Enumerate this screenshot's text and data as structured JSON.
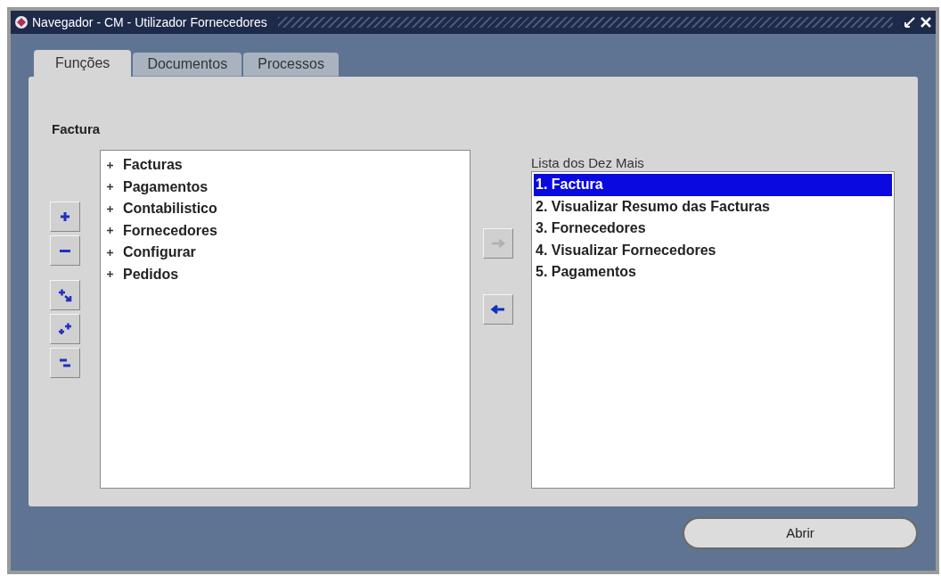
{
  "window": {
    "title": "Navegador - CM - Utilizador Fornecedores"
  },
  "tabs": [
    {
      "label": "Funções",
      "selected": true
    },
    {
      "label": "Documentos",
      "selected": false
    },
    {
      "label": "Processos",
      "selected": false
    }
  ],
  "tree": {
    "label": "Factura",
    "items": [
      {
        "label": "Facturas",
        "expanded": false
      },
      {
        "label": "Pagamentos",
        "expanded": false
      },
      {
        "label": "Contabilistico",
        "expanded": false
      },
      {
        "label": "Fornecedores",
        "expanded": false
      },
      {
        "label": "Configurar",
        "expanded": false
      },
      {
        "label": "Pedidos",
        "expanded": false
      }
    ]
  },
  "tree_buttons": [
    {
      "kind": "expand"
    },
    {
      "kind": "collapse"
    },
    {
      "kind": "expand-branch"
    },
    {
      "kind": "expand-all"
    },
    {
      "kind": "collapse-all"
    }
  ],
  "move_buttons": [
    {
      "kind": "add",
      "disabled": true
    },
    {
      "kind": "remove",
      "disabled": false
    }
  ],
  "top_ten": {
    "label": "Lista dos Dez Mais",
    "items": [
      {
        "label": "1. Factura",
        "selected": true
      },
      {
        "label": "2. Visualizar Resumo das Facturas",
        "selected": false
      },
      {
        "label": "3. Fornecedores",
        "selected": false
      },
      {
        "label": "4. Visualizar Fornecedores",
        "selected": false
      },
      {
        "label": "5. Pagamentos",
        "selected": false
      }
    ]
  },
  "open_button": {
    "label": "Abrir"
  }
}
